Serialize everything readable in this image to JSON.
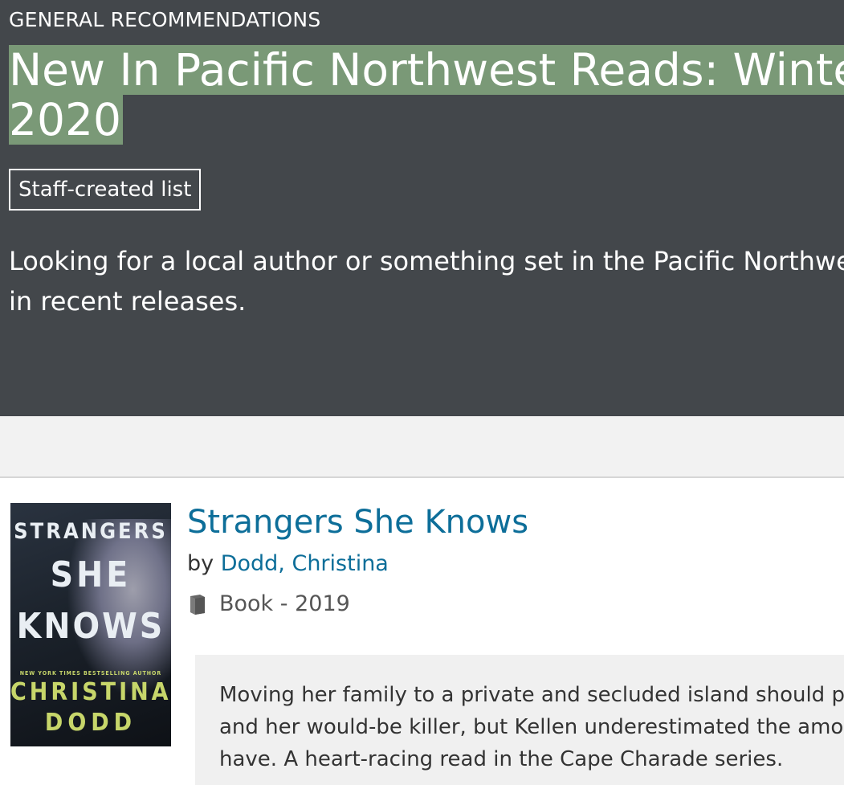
{
  "list": {
    "category": "GENERAL RECOMMENDATIONS",
    "title_line1": "New In Pacific Northwest Reads: Winter",
    "title_line2": "2020",
    "badge": "Staff-created list",
    "description_line1": "Looking for a local author or something set in the Pacific Northwest",
    "description_line2": "in recent releases."
  },
  "colors": {
    "hero_bg": "#43474b",
    "title_highlight": "#7a9977",
    "link": "#0d6e99",
    "annotation_bg": "#f0f0f0"
  },
  "item": {
    "title": "Strangers She Knows",
    "by_label": "by",
    "author": "Dodd, Christina",
    "format_icon": "book-icon",
    "format": "Book - 2019",
    "cover": {
      "line1": "STRANGERS",
      "line2": "SHE",
      "line3": "KNOWS",
      "tagline": "NEW YORK TIMES BESTSELLING AUTHOR",
      "author1": "CHRISTINA",
      "author2": "DODD"
    },
    "annotation_lines": [
      "Moving her family to a private and secluded island should put distance between",
      "and her would-be killer, but Kellen underestimated the amount of enemies she might",
      "have.  A heart-racing read in the Cape Charade series."
    ]
  }
}
